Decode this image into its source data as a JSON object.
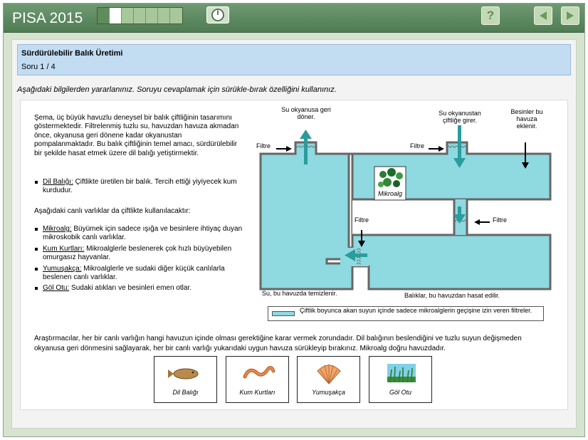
{
  "app": {
    "brand": "PISA 2015"
  },
  "progress": {
    "segments": [
      "done",
      "current",
      "todo",
      "todo",
      "todo",
      "todo",
      "todo"
    ]
  },
  "header": {
    "title": "Sürdürülebilir Balık Üretimi",
    "question_number": "Soru 1 / 4"
  },
  "toolbar": {
    "help_label": "?"
  },
  "instruction": "Aşağıdaki bilgilerden yararlanınız. Soruyu cevaplamak için sürükle-bırak özelliğini kullanınız.",
  "intro": "Şema, üç büyük havuzlu deneysel bir balık çiftliğinin tasarımını göstermektedir. Filtrelenmiş tuzlu su, havuzdan havuza akmadan önce, okyanusa geri dönene kadar okyanustan pompalanmaktadır. Bu balık çiftliğinin temel amacı, sürdürülebilir bir şekilde hasat etmek üzere dil balığı yetiştirmektir.",
  "fish_item": {
    "term": "Dil Balığı:",
    "desc": " Çiftlikte üretilen bir balık. Tercih ettiği yiyiyecek kum kurdudur."
  },
  "organisms_intro": "Aşağıdaki canlı varlıklar da çiftlikte kullanılacaktır:",
  "organisms": [
    {
      "term": "Mikroalg:",
      "desc": " Büyümek için sadece ışığa ve besinlere ihtiyaç duyan mikroskobik canlı varlıklar."
    },
    {
      "term": "Kum Kurtları:",
      "desc": " Mikroalglerle beslenerek çok hızlı büyüyebilen omurgasız hayvanlar."
    },
    {
      "term": "Yumuşakça:",
      "desc": " Mikroalglerle ve sudaki diğer küçük canlılarla beslenen canlı varlıklar."
    },
    {
      "term": "Göl Otu:",
      "desc": " Sudaki atıkları ve besinleri emen otlar."
    }
  ],
  "diagram": {
    "return_label_1": "Su okyanusa geri",
    "return_label_2": "döner.",
    "enter_label_1": "Su okyanustan",
    "enter_label_2": "çiftliğe girer.",
    "nutrient_label_1": "Besinler bu",
    "nutrient_label_2": "havuza",
    "nutrient_label_3": "eklenir.",
    "filter_label": "Filtre",
    "microalgae_label": "Mikroalg",
    "clean_pool_label": "Su, bu havuzda temizlenir.",
    "harvest_label": "Balıklar, bu havuzdan hasat edilir."
  },
  "legend": "Çiftlik boyunca akan suyun içinde sadece mikroalglerin geçişine izin veren filtreler.",
  "bottom_text": "Araştırmacılar, her bir canlı varlığın hangi havuzun içinde olması gerektiğine karar vermek zorundadır. Dil balığının beslendiğini ve tuzlu suyun değişmeden okyanusa geri dönmesini sağlayarak, her bir canlı varlığı yukarıdaki uygun havuza sürükleyip bırakınız. Mikroalg doğru havuzdadır.",
  "cards": [
    "Dil Balığı",
    "Kum Kurtları",
    "Yumuşakça",
    "Göl Otu"
  ],
  "colors": {
    "water": "#8fd9e0",
    "arrow": "#2b9c9c",
    "header_blue": "#c2dcf2",
    "bar_green": "#5f8c5a"
  }
}
